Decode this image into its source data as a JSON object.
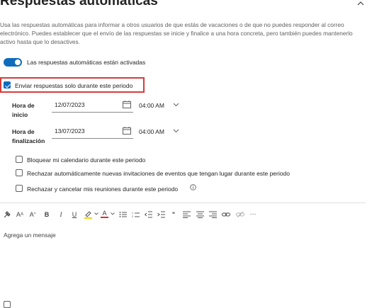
{
  "header": {
    "title": "Respuestas automáticas"
  },
  "description": "Usa las respuestas automáticas para informar a otros usuarios de que estás de vacaciones o de que no puedes responder al correo electrónico. Puedes establecer que el envío de las respuestas se inicie y finalice a una hora concreta, pero también puedes mantenerlo activo hasta que lo desactives.",
  "toggle": {
    "label": "Las respuestas automáticas están activadas",
    "on": true
  },
  "period": {
    "label": "Enviar respuestas solo durante este periodo",
    "checked": true
  },
  "start": {
    "label_line1": "Hora de",
    "label_line2": "inicio",
    "date": "12/07/2023",
    "time": "04:00 AM"
  },
  "end": {
    "label_line1": "Hora de",
    "label_line2": "finalización",
    "date": "13/07/2023",
    "time": "04:00 AM"
  },
  "options": [
    {
      "label": "Bloquear mi calendario durante este periodo",
      "checked": false
    },
    {
      "label": "Rechazar automáticamente nuevas invitaciones de eventos que tengan lugar durante este periodo",
      "checked": false
    },
    {
      "label": "Rechazar y cancelar mis reuniones durante este periodo",
      "checked": false
    }
  ],
  "toolbar": {
    "font_size_label": "A",
    "font_grow_label": "A",
    "bold": "B",
    "italic": "I",
    "underline": "U",
    "font_color": "A",
    "quote": "\"",
    "more": "···"
  },
  "editor": {
    "placeholder": "Agrega un mensaje"
  },
  "colors": {
    "accent": "#0f6cbd",
    "highlight": "#d83b3b",
    "highlighter": "#f5d30f",
    "font_color": "#d13438"
  }
}
